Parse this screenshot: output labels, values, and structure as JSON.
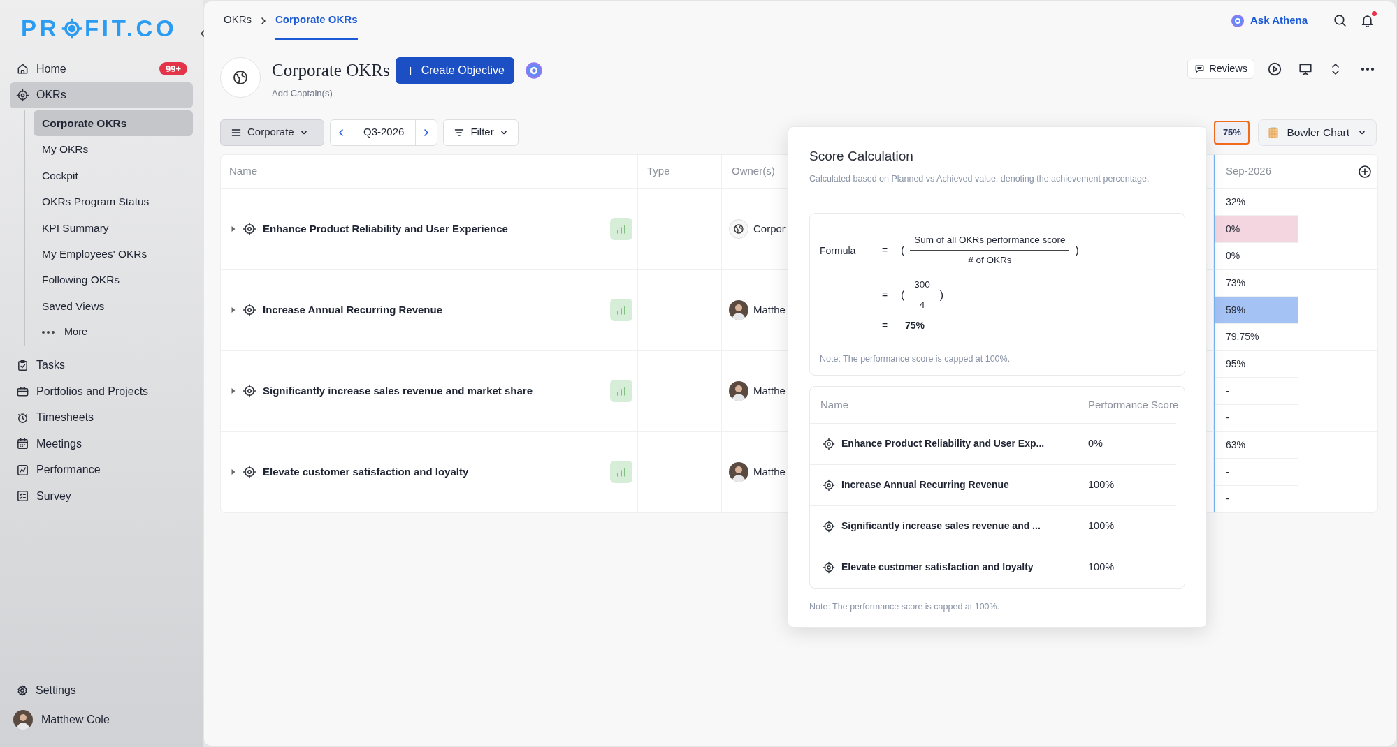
{
  "sidebar": {
    "logo": {
      "left": "PR",
      "right": "FIT.CO"
    },
    "items": [
      {
        "label": "Home",
        "badge": "99+",
        "selected": false
      },
      {
        "label": "OKRs",
        "selected": true,
        "expanded": true,
        "children": [
          {
            "label": "Corporate OKRs",
            "kind": "link",
            "selected": true
          },
          {
            "label": "My OKRs",
            "kind": "link",
            "selected": false
          },
          {
            "label": "Cockpit",
            "kind": "link",
            "selected": false
          },
          {
            "label": "OKRs Program Status",
            "kind": "link",
            "selected": false
          },
          {
            "label": "KPI Summary",
            "kind": "link",
            "selected": false
          },
          {
            "label": "My Employees' OKRs",
            "kind": "link",
            "selected": false
          },
          {
            "label": "Following OKRs",
            "kind": "link",
            "selected": false
          },
          {
            "label": "Saved Views",
            "kind": "link",
            "selected": false
          },
          {
            "label": "More",
            "kind": "more",
            "selected": false
          }
        ]
      },
      {
        "label": "Tasks",
        "selected": false
      },
      {
        "label": "Portfolios and Projects",
        "selected": false
      },
      {
        "label": "Timesheets",
        "selected": false
      },
      {
        "label": "Meetings",
        "selected": false
      },
      {
        "label": "Performance",
        "selected": false
      },
      {
        "label": "Survey",
        "selected": false
      }
    ],
    "footer": [
      {
        "label": "Settings",
        "kind": "settings"
      },
      {
        "label": "Matthew Cole",
        "kind": "user"
      }
    ]
  },
  "top_bar": {
    "breadcrumbs": [
      {
        "label": "OKRs",
        "selected": false
      },
      {
        "label": "Corporate OKRs",
        "selected": true
      }
    ],
    "assistant": "Ask Athena",
    "notifications": {
      "unread": true
    }
  },
  "header": {
    "title": "Corporate OKRs",
    "create_button": "Create Objective",
    "subtitle": "Add Captain(s)",
    "reviews_button": "Reviews"
  },
  "toolbar": {
    "view": "Corporate",
    "period": "Q3-2026",
    "filter": "Filter",
    "score": {
      "label": "75%",
      "highlighted": true
    },
    "chart_view": "Bowler Chart"
  },
  "table": {
    "columns": [
      "Name",
      "Type",
      "Owner(s)",
      "Sep-2026"
    ],
    "rows": [
      {
        "name": "Enhance Product Reliability and User Experience",
        "expanded": false,
        "owner": {
          "kind": "team",
          "name": "Corpor"
        },
        "cells": [
          {
            "value": "32%"
          },
          {
            "value": "0%",
            "color": "#f3d6df"
          },
          {
            "value": "0%"
          }
        ]
      },
      {
        "name": "Increase Annual Recurring Revenue",
        "expanded": false,
        "owner": {
          "kind": "person",
          "name": "Matthe"
        },
        "cells": [
          {
            "value": "73%"
          },
          {
            "value": "59%",
            "color": "#a5c2f4"
          },
          {
            "value": "79.75%"
          }
        ]
      },
      {
        "name": "Significantly increase sales revenue and market share",
        "expanded": false,
        "owner": {
          "kind": "person",
          "name": "Matthe"
        },
        "cells": [
          {
            "value": "95%"
          },
          {
            "value": "-"
          },
          {
            "value": "-"
          }
        ]
      },
      {
        "name": "Elevate customer satisfaction and loyalty",
        "expanded": false,
        "owner": {
          "kind": "person",
          "name": "Matthe"
        },
        "cells": [
          {
            "value": "63%"
          },
          {
            "value": "-"
          },
          {
            "value": "-"
          }
        ]
      }
    ]
  },
  "score_popover": {
    "title": "Score Calculation",
    "subtitle": "Calculated based on Planned vs Achieved value, denoting the achievement percentage.",
    "formula": {
      "lines": [
        {
          "kind": "fraction",
          "label": "Formula",
          "sign": "=",
          "open": "(",
          "numerator": "Sum of all OKRs performance score",
          "denominator": "# of OKRs",
          "close": ")"
        },
        {
          "kind": "fraction",
          "sign": "=",
          "open": "(",
          "numerator": "300",
          "denominator": "4",
          "close": ")"
        },
        {
          "kind": "value",
          "sign": "=",
          "value": "75%"
        }
      ],
      "note": "Note: The performance score is capped at 100%."
    },
    "table": {
      "columns": [
        "Name",
        "Performance Score"
      ],
      "rows": [
        {
          "name": "Enhance Product Reliability and User Exp...",
          "score": "0%"
        },
        {
          "name": "Increase Annual Recurring Revenue",
          "score": "100%"
        },
        {
          "name": "Significantly increase sales revenue and ...",
          "score": "100%"
        },
        {
          "name": "Elevate customer satisfaction and loyalty",
          "score": "100%"
        }
      ]
    },
    "note": "Note: The performance score is capped at 100%."
  }
}
